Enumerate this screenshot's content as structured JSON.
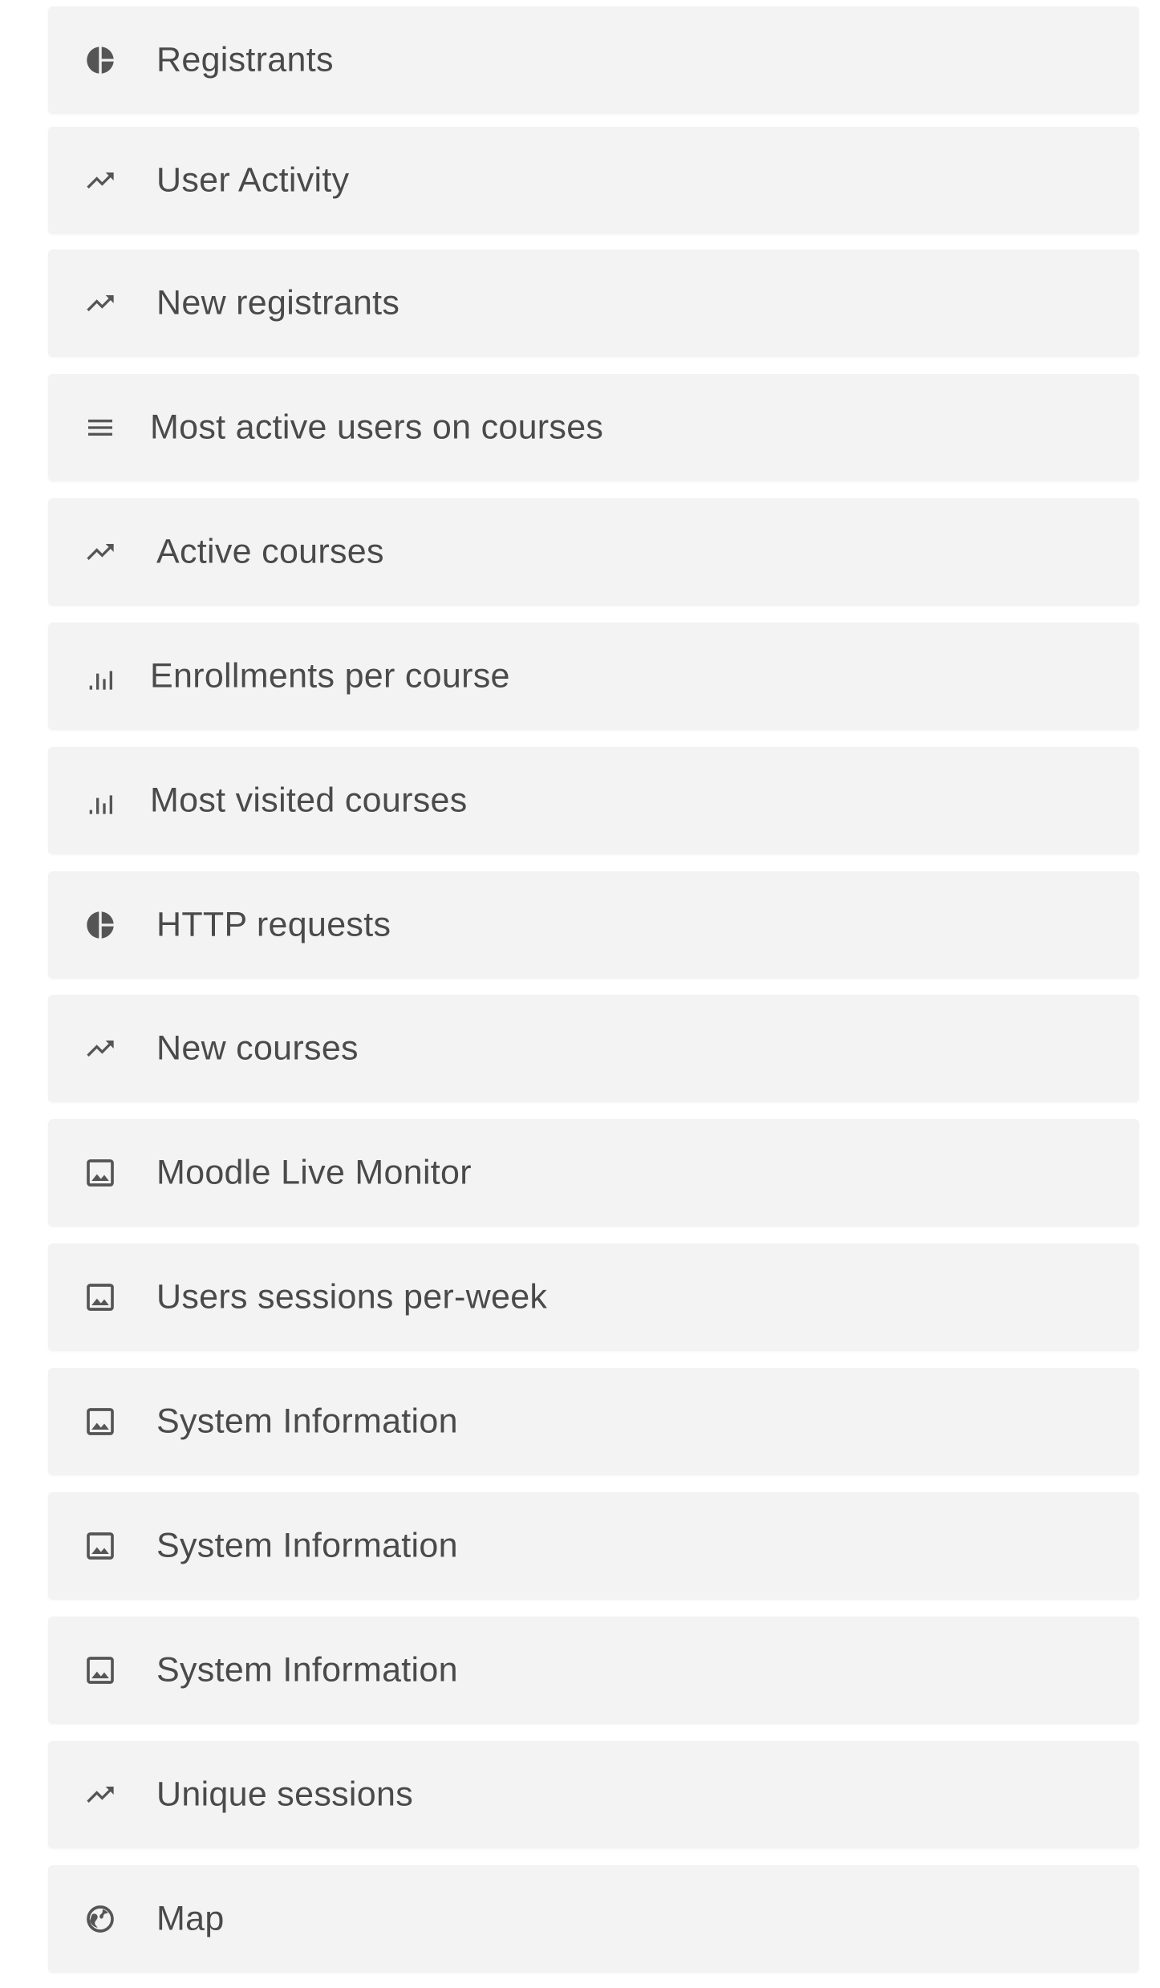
{
  "reports": [
    {
      "label": "Registrants",
      "icon": "pie-chart-icon"
    },
    {
      "label": "User Activity",
      "icon": "trending-up-icon"
    },
    {
      "label": "New registrants",
      "icon": "trending-up-icon"
    },
    {
      "label": "Most active users on courses",
      "icon": "list-icon"
    },
    {
      "label": "Active courses",
      "icon": "trending-up-icon"
    },
    {
      "label": "Enrollments per course",
      "icon": "bar-chart-icon"
    },
    {
      "label": "Most visited courses",
      "icon": "bar-chart-icon"
    },
    {
      "label": "HTTP requests",
      "icon": "pie-chart-icon"
    },
    {
      "label": "New courses",
      "icon": "trending-up-icon"
    },
    {
      "label": "Moodle Live Monitor",
      "icon": "image-icon"
    },
    {
      "label": "Users sessions per-week",
      "icon": "image-icon"
    },
    {
      "label": "System Information",
      "icon": "image-icon"
    },
    {
      "label": "System Information",
      "icon": "image-icon"
    },
    {
      "label": "System Information",
      "icon": "image-icon"
    },
    {
      "label": "Unique sessions",
      "icon": "trending-up-icon"
    },
    {
      "label": "Map",
      "icon": "globe-icon"
    }
  ],
  "colors": {
    "card_background": "#f3f3f3",
    "text": "#4a4a4a",
    "icon": "#555555"
  }
}
